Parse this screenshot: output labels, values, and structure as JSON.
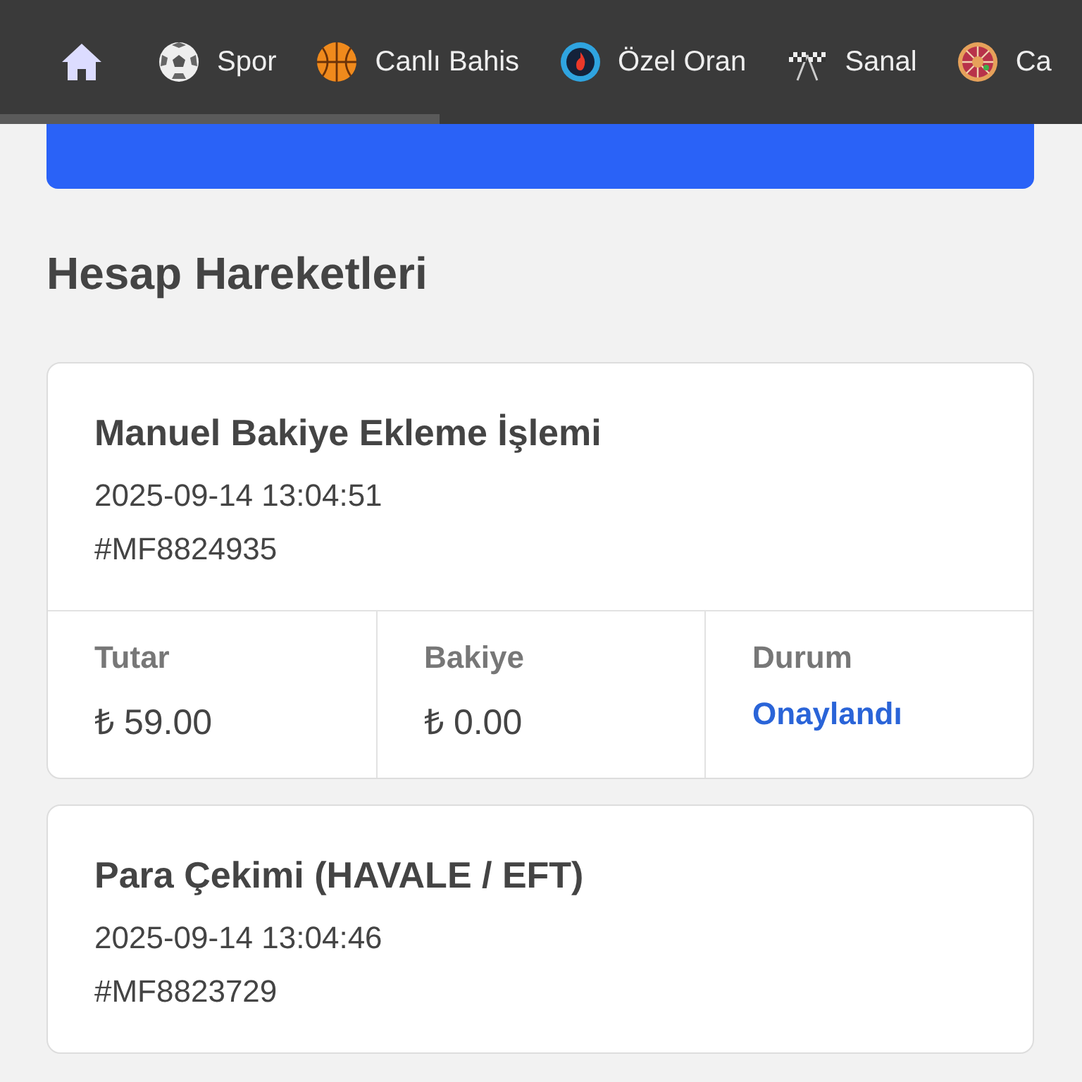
{
  "nav": {
    "items": [
      {
        "kind": "home"
      },
      {
        "kind": "soccer",
        "label": "Spor"
      },
      {
        "kind": "basketball",
        "label": "Canlı Bahis"
      },
      {
        "kind": "odds",
        "label": "Özel Oran"
      },
      {
        "kind": "flags",
        "label": "Sanal"
      },
      {
        "kind": "roulette",
        "label": "Ca"
      }
    ]
  },
  "heading": "Hesap Hareketleri",
  "transactions": [
    {
      "title": "Manuel Bakiye Ekleme İşlemi",
      "date": "2025-09-14 13:04:51",
      "id": "#MF8824935",
      "details": [
        {
          "label": "Tutar",
          "value": "₺ 59.00"
        },
        {
          "label": "Bakiye",
          "value": "₺ 0.00"
        },
        {
          "label": "Durum",
          "value": "Onaylandı",
          "color": "#2a64d8"
        }
      ]
    },
    {
      "title": "Para Çekimi (HAVALE / EFT)",
      "date": "2025-09-14 13:04:46",
      "id": "#MF8823729"
    }
  ]
}
